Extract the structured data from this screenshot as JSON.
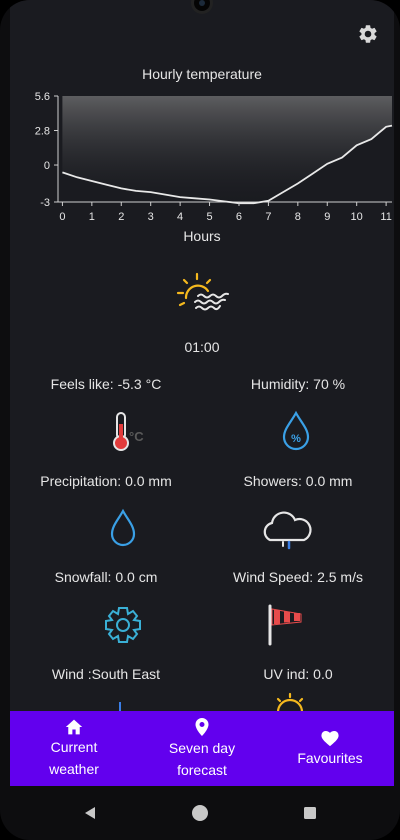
{
  "chart": {
    "title": "Hourly temperature",
    "xlabel": "Hours"
  },
  "chart_data": {
    "type": "area",
    "title": "Hourly temperature",
    "xlabel": "Hours",
    "ylabel": "",
    "x": [
      0,
      0.5,
      1,
      1.5,
      2,
      2.5,
      3,
      3.5,
      4,
      4.5,
      5,
      5.5,
      6,
      6.5,
      7,
      7.5,
      8,
      8.5,
      9,
      9.5,
      10,
      10.5,
      11,
      11.2
    ],
    "values": [
      -0.6,
      -1.0,
      -1.3,
      -1.6,
      -1.9,
      -2.1,
      -2.2,
      -2.4,
      -2.6,
      -2.7,
      -2.8,
      -2.95,
      -3.1,
      -3.1,
      -2.9,
      -2.2,
      -1.5,
      -0.7,
      0.1,
      0.6,
      1.6,
      2.1,
      3.1,
      3.2
    ],
    "xticks": [
      "0",
      "1",
      "2",
      "3",
      "4",
      "5",
      "6",
      "7",
      "8",
      "9",
      "10",
      "11"
    ],
    "yticks": [
      "5.6",
      "2.8",
      "0",
      "-3"
    ],
    "ylim": [
      -3,
      5.6
    ],
    "xlim": [
      -0.15,
      11.2
    ],
    "grid": false,
    "colors": {
      "line": "#e8e8e8",
      "fill_top": "#9a9a9a",
      "fill_bottom": "#1a1b20"
    }
  },
  "current": {
    "icon": "sun-fog-icon",
    "time": "01:00"
  },
  "details": [
    {
      "label": "Feels like: -5.3 °C",
      "icon": "thermometer-icon"
    },
    {
      "label": "Humidity: 70 %",
      "icon": "humidity-drop-icon"
    },
    {
      "label": "Precipitation: 0.0 mm",
      "icon": "raindrop-icon"
    },
    {
      "label": "Showers: 0.0 mm",
      "icon": "cloud-rain-icon"
    },
    {
      "label": "Snowfall: 0.0 cm",
      "icon": "gear-snowflake-icon"
    },
    {
      "label": "Wind Speed: 2.5 m/s",
      "icon": "windsock-icon"
    },
    {
      "label": "Wind :South East",
      "icon": "wind-direction-icon"
    },
    {
      "label": "UV ind: 0.0",
      "icon": "sun-icon"
    }
  ],
  "thermo_unit": "°C",
  "humidity_symbol": "%",
  "nav": {
    "items": [
      {
        "label": "Current\nweather",
        "icon": "home-icon"
      },
      {
        "label": "Seven day\nforecast",
        "icon": "location-pin-icon"
      },
      {
        "label": "Favourites",
        "icon": "heart-icon"
      }
    ],
    "background": "#6200ee"
  },
  "system_nav": [
    "back-icon",
    "home-circle-icon",
    "recents-icon"
  ]
}
